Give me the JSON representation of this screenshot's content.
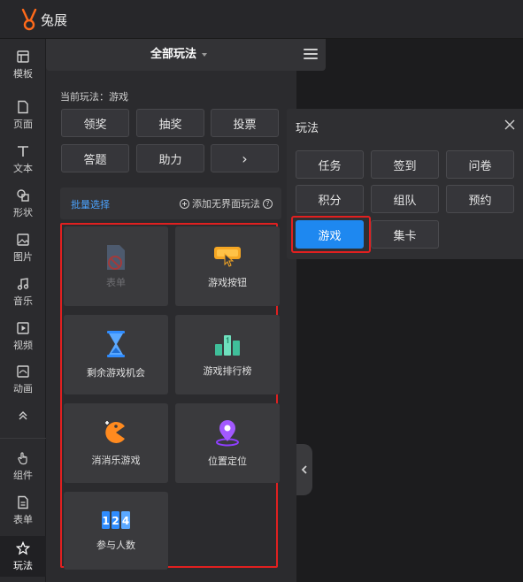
{
  "app": {
    "name": "兔展"
  },
  "nav": {
    "items": [
      {
        "label": "模板",
        "icon": "template-icon"
      },
      {
        "label": "页面",
        "icon": "page-icon"
      },
      {
        "label": "文本",
        "icon": "text-icon"
      },
      {
        "label": "形状",
        "icon": "shape-icon"
      },
      {
        "label": "图片",
        "icon": "image-icon"
      },
      {
        "label": "音乐",
        "icon": "music-icon"
      },
      {
        "label": "视频",
        "icon": "video-icon"
      },
      {
        "label": "动画",
        "icon": "animation-icon"
      },
      {
        "label": "组件",
        "icon": "component-icon"
      },
      {
        "label": "表单",
        "icon": "form-icon"
      },
      {
        "label": "玩法",
        "icon": "gameplay-icon"
      }
    ],
    "active": "玩法"
  },
  "panel": {
    "title": "全部玩法",
    "current_label": "当前玩法：游戏",
    "categories": [
      "领奖",
      "抽奖",
      "投票",
      "答题",
      "助力",
      "›"
    ],
    "batch_select": "批量选择",
    "add_label": "添加无界面玩法"
  },
  "cards": [
    {
      "label": "表单",
      "disabled": true
    },
    {
      "label": "游戏按钮"
    },
    {
      "label": "剩余游戏机会"
    },
    {
      "label": "游戏排行榜"
    },
    {
      "label": "消消乐游戏"
    },
    {
      "label": "位置定位"
    },
    {
      "label": "参与人数"
    }
  ],
  "popup": {
    "title": "玩法",
    "options": [
      "任务",
      "签到",
      "问卷",
      "积分",
      "组队",
      "预约",
      "游戏",
      "集卡"
    ],
    "selected": "游戏"
  },
  "colors": {
    "accent": "#1e88f0",
    "highlight": "#e02020",
    "orange": "#ff8a1f",
    "link": "#4ba3ff"
  }
}
